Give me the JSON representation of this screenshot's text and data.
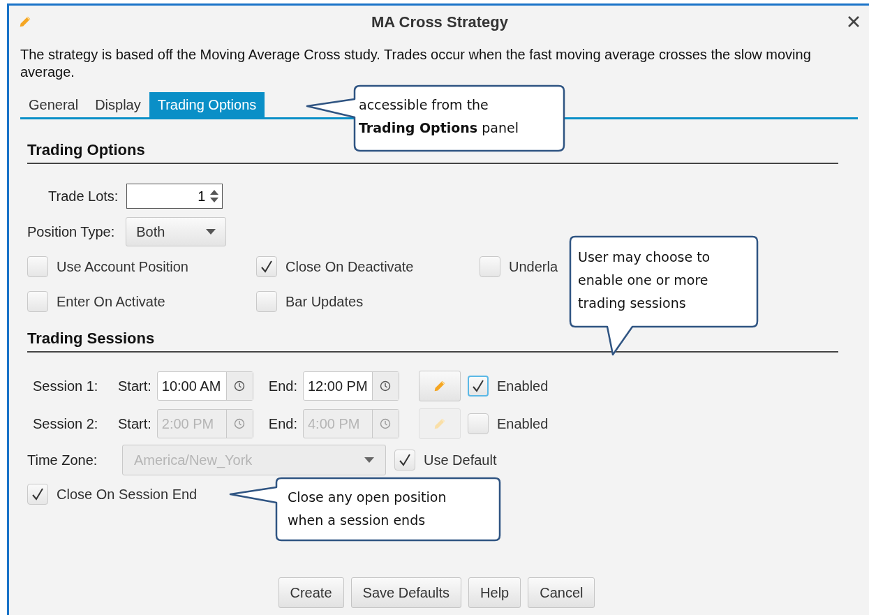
{
  "window": {
    "title": "MA Cross Strategy"
  },
  "description": "The strategy is based off the Moving Average Cross study.  Trades occur when the fast moving average crosses the slow moving average.",
  "tabs": [
    {
      "label": "General",
      "selected": false
    },
    {
      "label": "Display",
      "selected": false
    },
    {
      "label": "Trading Options",
      "selected": true
    }
  ],
  "trading_options": {
    "heading": "Trading Options",
    "trade_lots": {
      "label": "Trade Lots:",
      "value": "1"
    },
    "position_type": {
      "label": "Position Type:",
      "value": "Both"
    },
    "checkboxes": [
      [
        {
          "label": "Use Account Position",
          "checked": false
        },
        {
          "label": "Close On Deactivate",
          "checked": true
        },
        {
          "label": "Underla",
          "checked": false
        }
      ],
      [
        {
          "label": "Enter On Activate",
          "checked": false
        },
        {
          "label": "Bar Updates",
          "checked": false
        }
      ]
    ]
  },
  "trading_sessions": {
    "heading": "Trading Sessions",
    "sessions": [
      {
        "label": "Session 1:",
        "start_label": "Start:",
        "start": "10:00 AM",
        "end_label": "End:",
        "end": "12:00 PM",
        "disabled": false,
        "enabled_label": "Enabled",
        "enabled": true,
        "focused": true
      },
      {
        "label": "Session 2:",
        "start_label": "Start:",
        "start": "2:00 PM",
        "end_label": "End:",
        "end": "4:00 PM",
        "disabled": true,
        "enabled_label": "Enabled",
        "enabled": false,
        "focused": false
      }
    ],
    "time_zone": {
      "label": "Time Zone:",
      "value": "America/New_York",
      "disabled": true
    },
    "use_default": {
      "label": "Use Default",
      "checked": true
    },
    "close_on_session_end": {
      "label": "Close On Session End",
      "checked": true
    }
  },
  "buttons": [
    "Create",
    "Save Defaults",
    "Help",
    "Cancel"
  ],
  "callouts": [
    "accessible from the **Trading Options** panel",
    "User may choose to enable one or more trading sessions",
    "Close any open position when a session ends"
  ]
}
